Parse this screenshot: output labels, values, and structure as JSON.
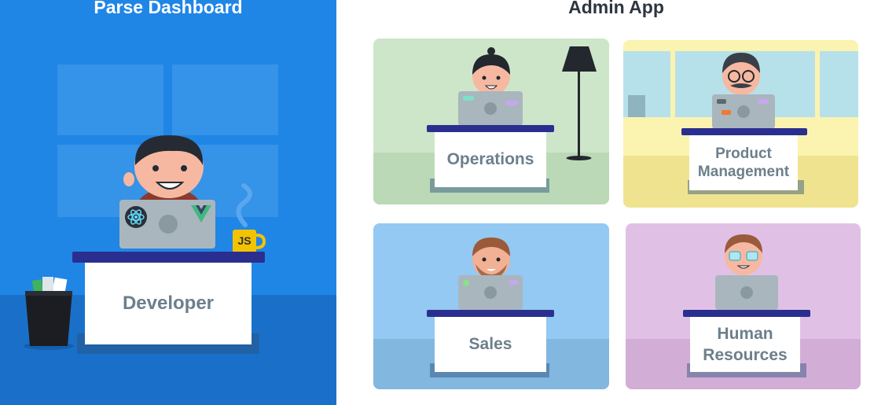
{
  "left_panel": {
    "title": "Parse Dashboard",
    "desk_label": "Developer",
    "mug_label": "JS",
    "colors": {
      "background": "#1f86e6",
      "floor": "#1a70c9"
    }
  },
  "right_panel": {
    "title": "Admin App",
    "cards": [
      {
        "label": "Operations",
        "bg": "#cde6c9",
        "floor": "#bcd9b7"
      },
      {
        "label": "Product Management",
        "bg": "#fbf3b0",
        "floor": "#efe38f"
      },
      {
        "label": "Sales",
        "bg": "#93c9f2",
        "floor": "#82b7df"
      },
      {
        "label": "Human Resources",
        "bg": "#e0c1e5",
        "floor": "#d2aed6"
      }
    ]
  },
  "colors": {
    "desk_top": "#2a2f8f",
    "desk_text": "#6c7f8c",
    "laptop": "#a9b6bd"
  }
}
